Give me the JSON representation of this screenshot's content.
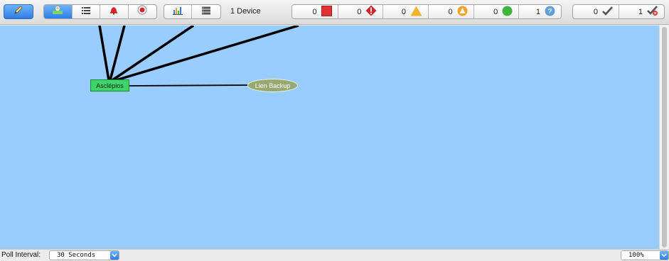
{
  "toolbar": {
    "edit_icon": "pencil-icon",
    "view_tabs": [
      {
        "icon": "map-view-icon",
        "active": true
      },
      {
        "icon": "list-view-icon",
        "active": false
      },
      {
        "icon": "bell-icon",
        "active": false
      },
      {
        "icon": "alarm-icon",
        "active": false
      }
    ],
    "report_tabs": [
      {
        "icon": "chart-icon"
      },
      {
        "icon": "server-list-icon"
      }
    ],
    "device_count": "1 Device",
    "status_counts": [
      {
        "count": "0",
        "icon": "down-square-icon",
        "color": "#e03131"
      },
      {
        "count": "0",
        "icon": "critical-diamond-icon",
        "color": "#d6232b"
      },
      {
        "count": "0",
        "icon": "warning-triangle-icon",
        "color": "#f0b62b"
      },
      {
        "count": "0",
        "icon": "minor-circle-icon",
        "color": "#f2a42a"
      },
      {
        "count": "0",
        "icon": "up-circle-icon",
        "color": "#3fb43f"
      },
      {
        "count": "1",
        "icon": "unknown-circle-icon",
        "color": "#5f9fdc"
      }
    ],
    "ack_counts": [
      {
        "count": "0",
        "icon": "acknowledged-check-icon"
      },
      {
        "count": "1",
        "icon": "unacknowledged-check-icon"
      }
    ]
  },
  "map": {
    "background": "#99ccff",
    "nodes": {
      "main": "Asclépios",
      "backup": "Lien Backup"
    }
  },
  "statusbar": {
    "poll_label": "Poll Interval:",
    "poll_value": "30 Seconds",
    "zoom_value": "100%"
  }
}
